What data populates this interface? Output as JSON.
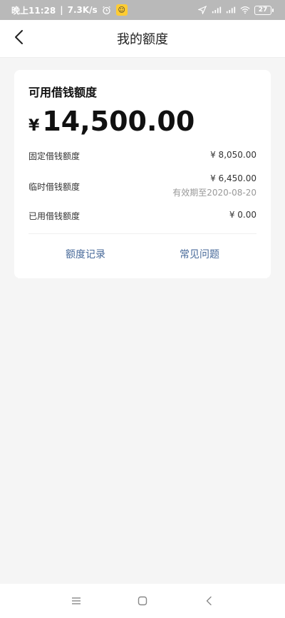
{
  "status_bar": {
    "time": "晚上11:28",
    "speed": "7.3K/s",
    "battery": "27"
  },
  "header": {
    "title": "我的额度"
  },
  "card": {
    "title": "可用借钱额度",
    "currency": "¥",
    "amount": "14,500.00",
    "rows": [
      {
        "label": "固定借钱额度",
        "value": "¥ 8,050.00"
      },
      {
        "label": "临时借钱额度",
        "value": "¥ 6,450.00",
        "sub": "有效期至2020-08-20"
      },
      {
        "label": "已用借钱额度",
        "value": "¥ 0.00"
      }
    ],
    "links": {
      "records": "额度记录",
      "faq": "常见问题"
    }
  },
  "colors": {
    "status_bar_bg": "#b9b9b9",
    "link": "#486a9a",
    "page_bg": "#f5f5f5"
  },
  "icons": {
    "back": "chevron-left-icon",
    "alarm": "alarm-clock-icon",
    "emoji": "emoji-face-icon",
    "location": "location-arrow-icon",
    "signal": "signal-bars-icon",
    "wifi": "wifi-icon",
    "menu": "menu-icon",
    "home": "home-square-icon",
    "nav_back": "nav-back-icon"
  }
}
